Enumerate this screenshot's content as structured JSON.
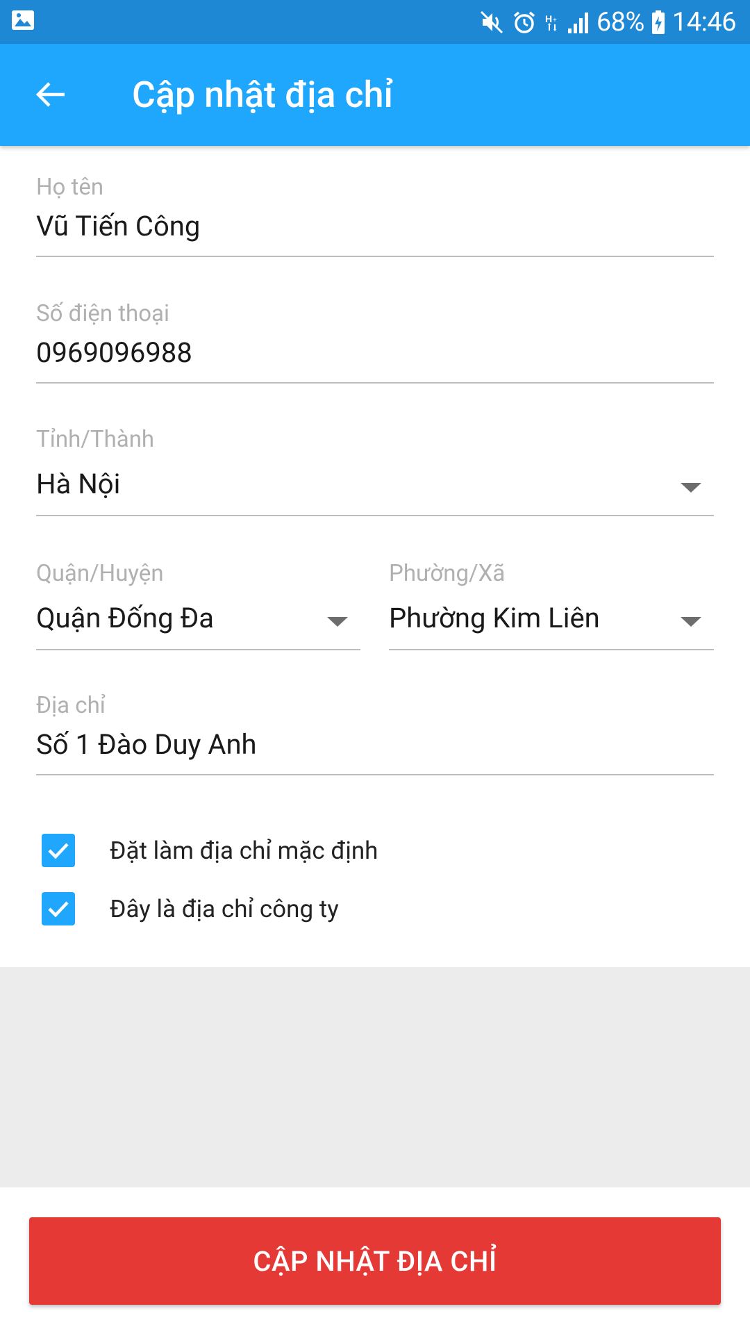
{
  "status_bar": {
    "battery_percent": "68%",
    "time": "14:46",
    "icons": [
      "gallery-icon",
      "mute-icon",
      "alarm-icon",
      "data-icon",
      "signal-icon",
      "battery-charging-icon"
    ]
  },
  "app_bar": {
    "title": "Cập nhật địa chỉ",
    "back_icon": "arrow-back-icon"
  },
  "form": {
    "full_name": {
      "label": "Họ tên",
      "value": "Vũ Tiến Công"
    },
    "phone": {
      "label": "Số điện thoại",
      "value": "0969096988"
    },
    "province": {
      "label": "Tỉnh/Thành",
      "value": "Hà Nội"
    },
    "district": {
      "label": "Quận/Huyện",
      "value": "Quận Đống Đa"
    },
    "ward": {
      "label": "Phường/Xã",
      "value": "Phường Kim Liên"
    },
    "address": {
      "label": "Địa chỉ",
      "value": "Số 1 Đào Duy Anh"
    },
    "default_address": {
      "label": "Đặt làm địa chỉ mặc định",
      "checked": true
    },
    "company_address": {
      "label": "Đây là địa chỉ công ty",
      "checked": true
    }
  },
  "submit_button": {
    "label": "CẬP NHẬT ĐỊA CHỈ"
  },
  "colors": {
    "status_bar": "#1e88d5",
    "app_bar": "#1ea7fd",
    "checkbox": "#1ea7fd",
    "submit": "#e53935",
    "gray_area": "#ececec"
  }
}
